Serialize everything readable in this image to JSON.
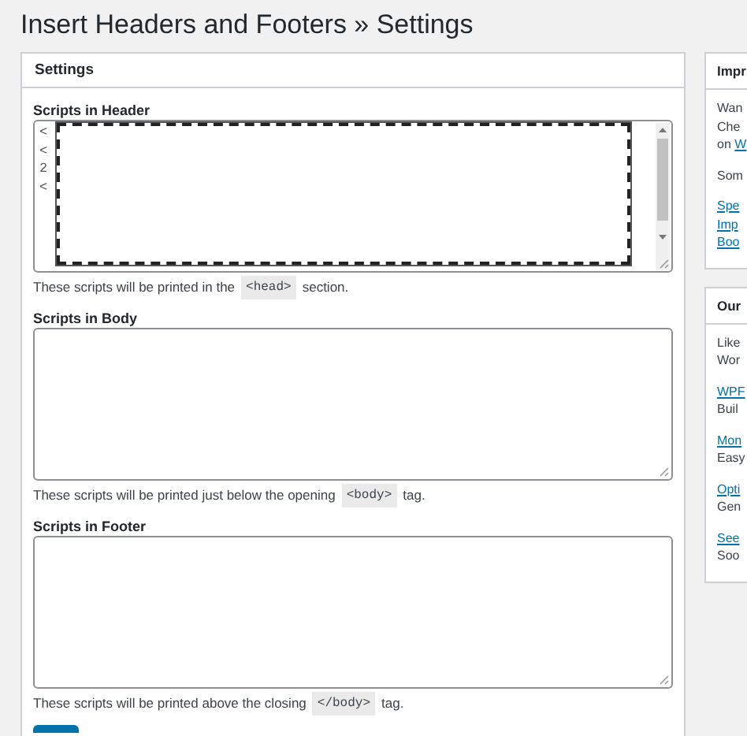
{
  "page_title": "Insert Headers and Footers » Settings",
  "settings": {
    "title": "Settings",
    "fields": [
      {
        "label": "Scripts in Header",
        "value_lines": [
          "<",
          "<",
          "2",
          "<"
        ],
        "redacted": true,
        "scrollbar": true,
        "help_before": "These scripts will be printed in the",
        "help_code": "<head>",
        "help_after": "section."
      },
      {
        "label": "Scripts in Body",
        "redacted": false,
        "scrollbar": false,
        "help_before": "These scripts will be printed just below the opening",
        "help_code": "<body>",
        "help_after": "tag."
      },
      {
        "label": "Scripts in Footer",
        "redacted": false,
        "scrollbar": false,
        "help_before": "These scripts will be printed above the closing",
        "help_code": "</body>",
        "help_after": "tag."
      }
    ]
  },
  "sidebar": [
    {
      "title": "Impr",
      "paragraphs": [
        [
          {
            "kind": "text",
            "text": "Wan"
          },
          {
            "kind": "text",
            "text": "Che"
          },
          {
            "kind": "mixed",
            "text": "on",
            "link": "W"
          }
        ],
        [
          {
            "kind": "text",
            "text": "Som"
          }
        ],
        [
          {
            "kind": "link",
            "text": "Spe"
          },
          {
            "kind": "link",
            "text": "Imp"
          },
          {
            "kind": "link",
            "text": "Boo"
          }
        ]
      ]
    },
    {
      "title": "Our",
      "paragraphs": [
        [
          {
            "kind": "text",
            "text": "Like"
          },
          {
            "kind": "text",
            "text": "Wor"
          }
        ],
        [
          {
            "kind": "link",
            "text": "WPF"
          },
          {
            "kind": "text",
            "text": "Buil"
          }
        ],
        [
          {
            "kind": "link",
            "text": "Mon"
          },
          {
            "kind": "text",
            "text": "Easy"
          }
        ],
        [
          {
            "kind": "link",
            "text": "Opti"
          },
          {
            "kind": "text",
            "text": "Gen"
          }
        ],
        [
          {
            "kind": "link",
            "text": "See"
          },
          {
            "kind": "text",
            "text": "Soo"
          }
        ]
      ]
    }
  ]
}
